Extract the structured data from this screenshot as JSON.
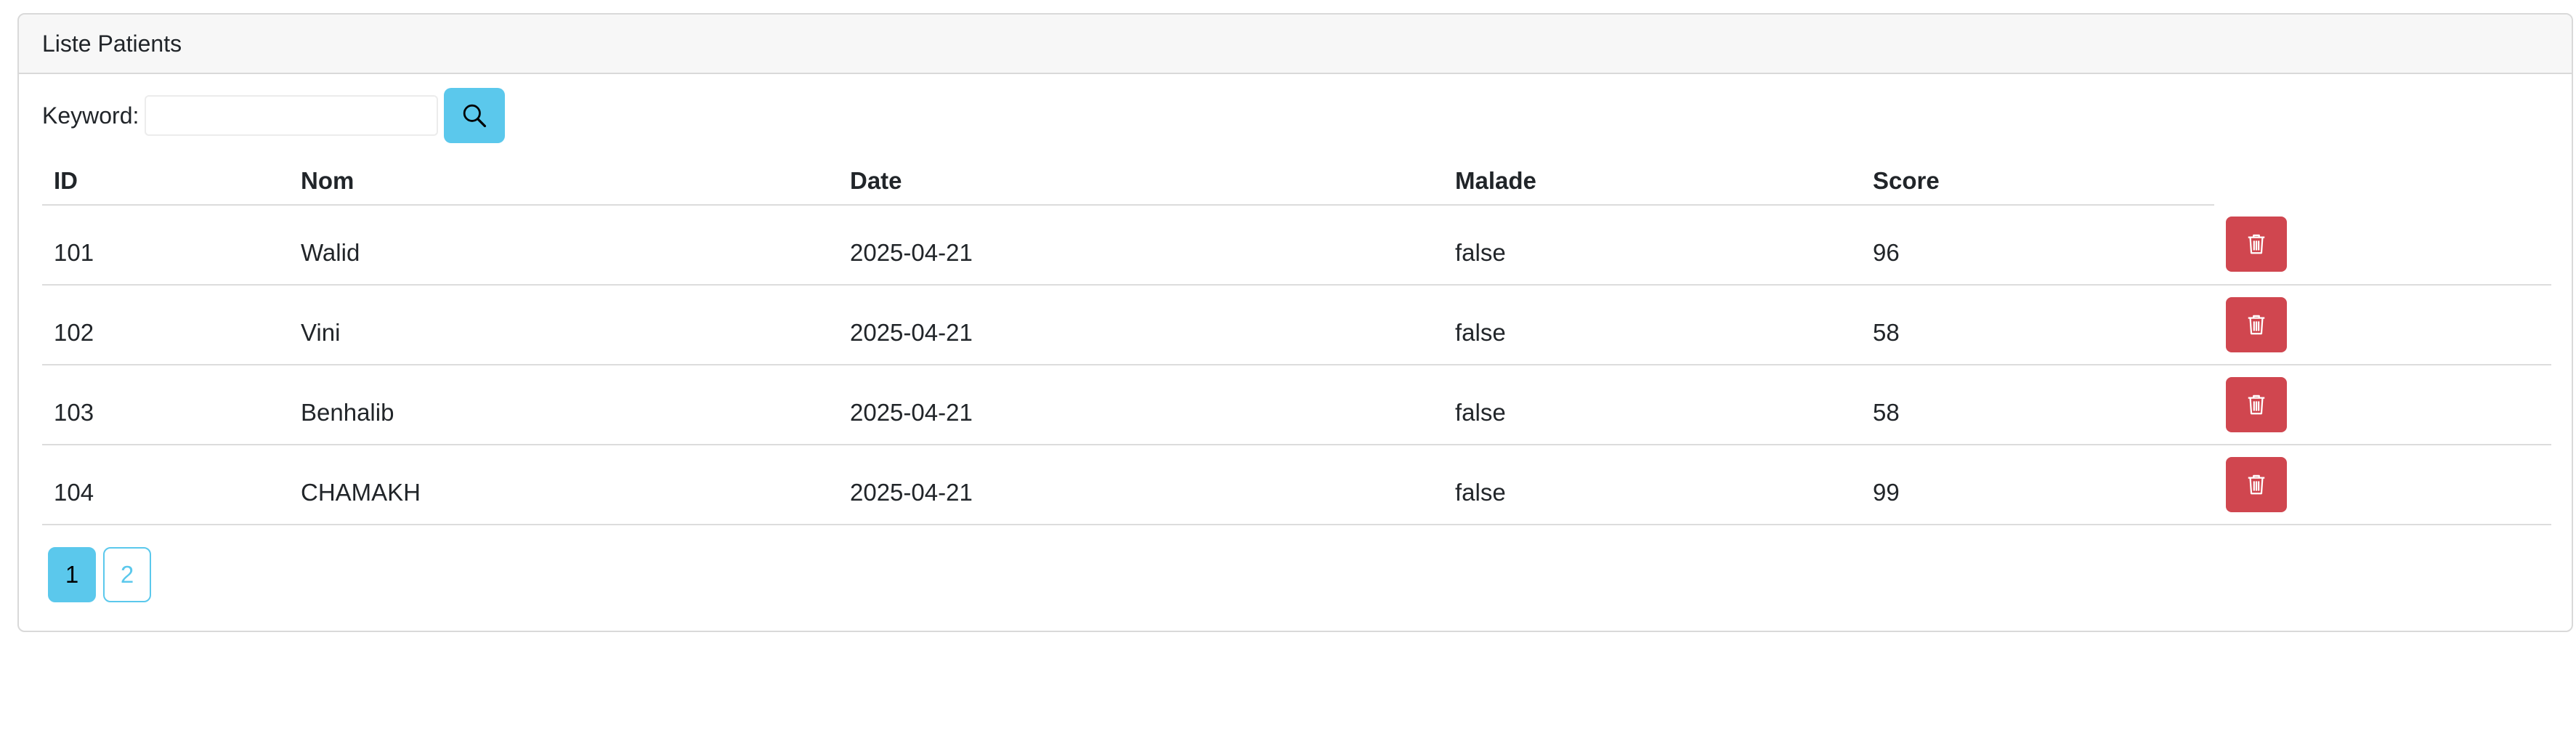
{
  "card": {
    "title": "Liste Patients"
  },
  "search": {
    "label": "Keyword:",
    "value": "",
    "placeholder": "",
    "button_icon": "search-icon"
  },
  "table": {
    "headers": [
      "ID",
      "Nom",
      "Date",
      "Malade",
      "Score"
    ],
    "rows": [
      {
        "id": "101",
        "nom": "Walid",
        "date": "2025-04-21",
        "malade": "false",
        "score": "96",
        "action_icon": "trash-icon"
      },
      {
        "id": "102",
        "nom": "Vini",
        "date": "2025-04-21",
        "malade": "false",
        "score": "58",
        "action_icon": "trash-icon"
      },
      {
        "id": "103",
        "nom": "Benhalib",
        "date": "2025-04-21",
        "malade": "false",
        "score": "58",
        "action_icon": "trash-icon"
      },
      {
        "id": "104",
        "nom": "CHAMAKH",
        "date": "2025-04-21",
        "malade": "false",
        "score": "99",
        "action_icon": "trash-icon"
      }
    ]
  },
  "pagination": {
    "pages": [
      "1",
      "2"
    ],
    "current": "1"
  },
  "colors": {
    "info": "#5bc8ec",
    "danger": "#d0464f",
    "header_bg": "#f7f7f7"
  }
}
